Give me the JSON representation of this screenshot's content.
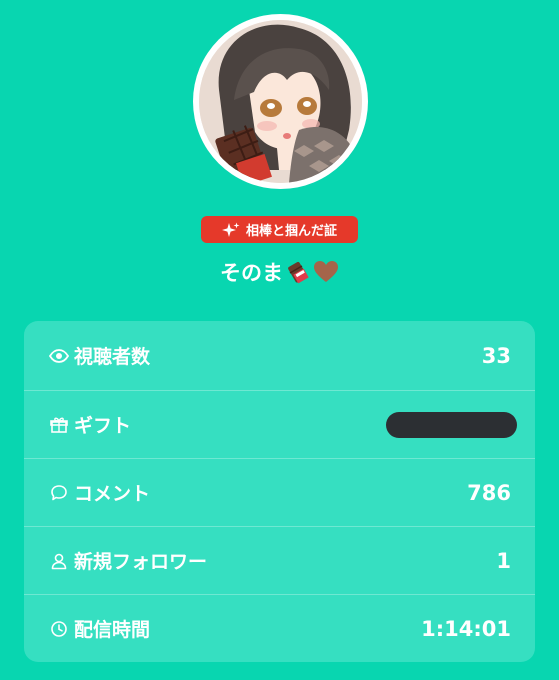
{
  "profile": {
    "badge_label": "相棒と掴んだ証",
    "username": "そのま",
    "emojis": [
      "chocolate-bar-emoji",
      "brown-heart-emoji"
    ]
  },
  "stats": [
    {
      "icon": "eye-icon",
      "label": "視聴者数",
      "value": "33"
    },
    {
      "icon": "gift-icon",
      "label": "ギフト",
      "value": ""
    },
    {
      "icon": "comment-icon",
      "label": "コメント",
      "value": "786"
    },
    {
      "icon": "user-icon",
      "label": "新規フォロワー",
      "value": "1"
    },
    {
      "icon": "clock-icon",
      "label": "配信時間",
      "value": "1:14:01"
    }
  ],
  "colors": {
    "background": "#08d6b0",
    "card": "#36dfc1",
    "badge": "#e5392a"
  }
}
